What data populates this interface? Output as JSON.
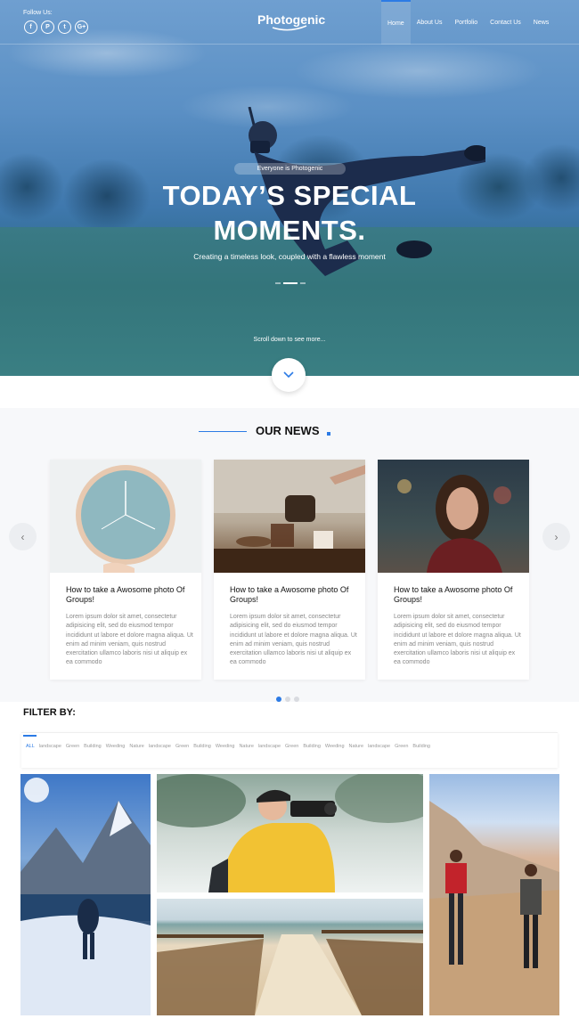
{
  "header": {
    "follow_label": "Follow Us:",
    "socials": [
      {
        "icon": "facebook-icon",
        "glyph": "f"
      },
      {
        "icon": "pinterest-icon",
        "glyph": "P"
      },
      {
        "icon": "twitter-icon",
        "glyph": "t"
      },
      {
        "icon": "googleplus-icon",
        "glyph": "G+"
      }
    ],
    "logo": "Photogenic",
    "nav": [
      "Home",
      "About Us",
      "Portfolio",
      "Contact Us",
      "News"
    ],
    "nav_active": "Home"
  },
  "hero": {
    "tagline": "Everyone is Photogenic",
    "title_line1": "TODAY’S SPECIAL",
    "title_line2": "MOMENTS.",
    "subtitle": "Creating a timeless look, coupled with a flawless moment",
    "scroll_text": "Scroll down to see more..."
  },
  "news": {
    "title": "OUR NEWS",
    "cards": [
      {
        "title": "How to take a Awosome photo Of Groups!",
        "text": "Lorem ipsum dolor sit amet, consectetur adipisicing elit, sed do eiusmod tempor incididunt ut labore et dolore magna aliqua. Ut enim ad minim veniam, quis nostrud exercitation ullamco laboris nisi ut aliquip ex ea commodo",
        "image": "wall-clock"
      },
      {
        "title": "How to take a Awosome photo Of Groups!",
        "text": "Lorem ipsum dolor sit amet, consectetur adipisicing elit, sed do eiusmod tempor incididunt ut labore et dolore magna aliqua. Ut enim ad minim veniam, quis nostrud exercitation ullamco laboris nisi ut aliquip ex ea commodo",
        "image": "coffee-pour"
      },
      {
        "title": "How to take a Awosome photo Of Groups!",
        "text": "Lorem ipsum dolor sit amet, consectetur adipisicing elit, sed do eiusmod tempor incididunt ut labore et dolore magna aliqua. Ut enim ad minim veniam, quis nostrud exercitation ullamco laboris nisi ut aliquip ex ea commodo",
        "image": "woman-portrait"
      }
    ],
    "prev_icon": "‹",
    "next_icon": "›"
  },
  "filter": {
    "title": "FILTER BY:",
    "tags": [
      "ALL",
      "landscape",
      "Green",
      "Building",
      "Weeding",
      "Nature",
      "landscape",
      "Green",
      "Building",
      "Weeding",
      "Nature",
      "landscape",
      "Green",
      "Building",
      "Weeding",
      "Nature",
      "landscape",
      "Green",
      "Building"
    ],
    "active": "ALL"
  },
  "colors": {
    "accent": "#2c7be5"
  }
}
